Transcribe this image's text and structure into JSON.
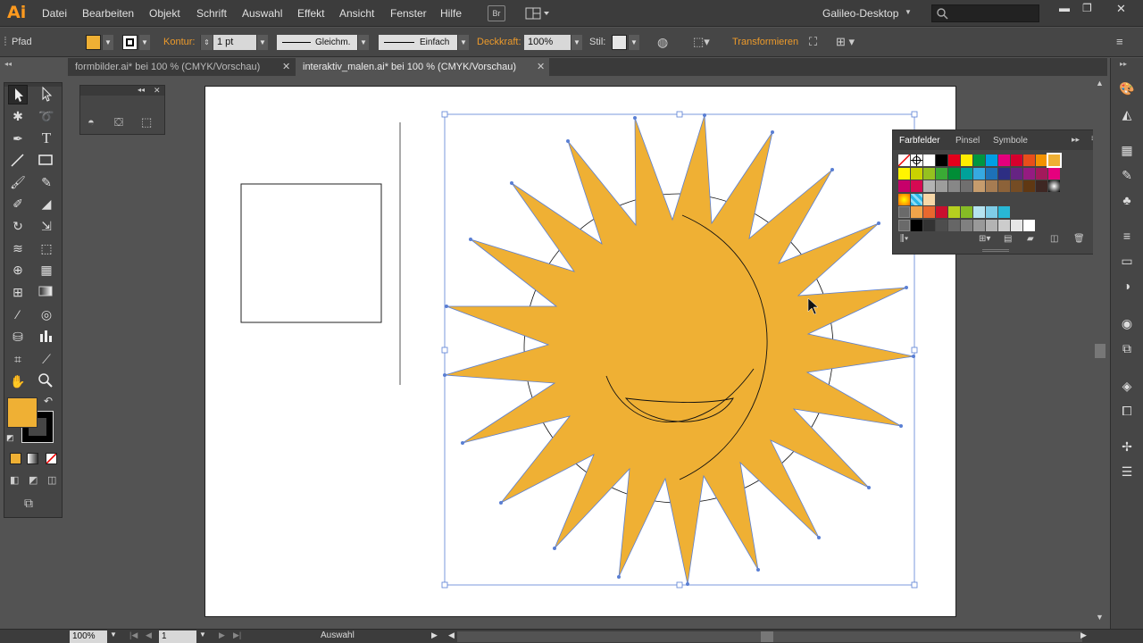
{
  "app": {
    "logo": "Ai",
    "menu": [
      "Datei",
      "Bearbeiten",
      "Objekt",
      "Schrift",
      "Auswahl",
      "Effekt",
      "Ansicht",
      "Fenster",
      "Hilfe"
    ],
    "bridge_label": "Br",
    "workspace": "Galileo-Desktop",
    "search_placeholder": ""
  },
  "control": {
    "object_type": "Pfad",
    "kontur_label": "Kontur:",
    "stroke_weight": "1 pt",
    "profile_label": "Gleichm.",
    "brush_label": "Einfach",
    "opacity_label": "Deckkraft:",
    "opacity_value": "100%",
    "style_label": "Stil:",
    "transform_label": "Transformieren"
  },
  "colors": {
    "fill": "#efb034",
    "accent": "#ec9a2b",
    "selection": "#5a7fd4"
  },
  "tabs": [
    {
      "label": "formbilder.ai* bei 100 % (CMYK/Vorschau)",
      "active": false
    },
    {
      "label": "interaktiv_malen.ai* bei 100 % (CMYK/Vorschau)",
      "active": true
    }
  ],
  "swatches_panel": {
    "tabs": [
      "Farbfelder",
      "Pinsel",
      "Symbole"
    ]
  },
  "status": {
    "zoom": "100%",
    "artboard_number": "1",
    "tool_text": "Auswahl"
  },
  "icons": {
    "tools": [
      "selection-tool-icon",
      "direct-selection-tool-icon",
      "magic-wand-icon",
      "lasso-icon",
      "pen-tool-icon",
      "type-tool-icon",
      "line-tool-icon",
      "rectangle-tool-icon",
      "paintbrush-icon",
      "pencil-icon",
      "blob-brush-icon",
      "eraser-icon",
      "rotate-tool-icon",
      "scale-tool-icon",
      "warp-tool-icon",
      "free-transform-icon",
      "shape-builder-icon",
      "perspective-grid-icon",
      "mesh-tool-icon",
      "gradient-tool-icon",
      "eyedropper-icon",
      "blend-tool-icon",
      "symbol-sprayer-icon",
      "column-graph-icon",
      "artboard-tool-icon",
      "slice-tool-icon",
      "hand-tool-icon",
      "zoom-tool-icon"
    ]
  }
}
